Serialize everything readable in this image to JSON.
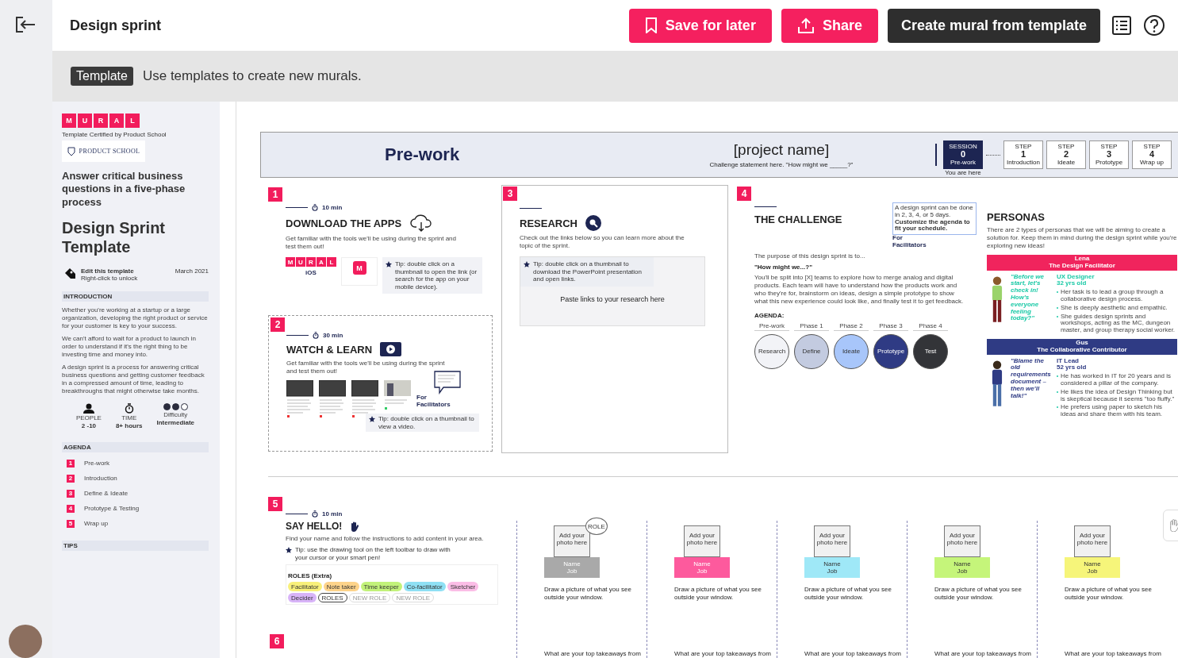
{
  "topbar": {
    "title": "Design sprint",
    "buttons": [
      {
        "label": "Save for later",
        "kind": "save"
      },
      {
        "label": "Share",
        "kind": "share"
      },
      {
        "label": "Create mural from template",
        "kind": "create"
      }
    ]
  },
  "banner": {
    "badge": "Template",
    "text": "Use templates to create new murals."
  },
  "sidebar": {
    "logo_letters": [
      "M",
      "U",
      "R",
      "A",
      "L"
    ],
    "certified": "Template Certified by Product School",
    "partner": "PRODUCT SCHOOL",
    "subtitle": "Answer critical business questions in a five-phase process",
    "title": "Design Sprint Template",
    "edit_title": "Edit this template",
    "edit_hint": "Right-click to unlock",
    "date": "March 2021",
    "intro_heading": "INTRODUCTION",
    "intro_paragraphs": [
      "Whether you're working at a startup or a large organization, developing the right product or service for your customer is key to your success.",
      "We can't afford to wait for a product to launch in order to understand if it's the right thing to be investing time and money into.",
      "A design sprint is a process for answering critical business questions and getting customer feedback in a compressed amount of time, leading to breakthroughs that might otherwise take months."
    ],
    "stats": [
      {
        "kind": "people",
        "label": "PEOPLE",
        "value": "2 -10"
      },
      {
        "kind": "time",
        "label": "TIME",
        "value": "8+ hours"
      },
      {
        "kind": "difficulty",
        "label": "Difficulty",
        "value": "Intermediate",
        "stars": 2
      }
    ],
    "agenda_heading": "AGENDA",
    "agenda": [
      {
        "number": "1",
        "label": "Pre-work"
      },
      {
        "number": "2",
        "label": "Introduction"
      },
      {
        "number": "3",
        "label": "Define & Ideate"
      },
      {
        "number": "4",
        "label": "Prototype & Testing"
      },
      {
        "number": "5",
        "label": "Wrap up"
      }
    ],
    "tips_heading": "TIPS"
  },
  "canvas": {
    "header": {
      "title": "Pre-work",
      "project": "[project name]",
      "challenge": "Challenge statement here. \"How might we _____?\"",
      "here_note": "You are here",
      "steps": [
        {
          "label": "SESSION",
          "number": "0",
          "name": "Pre-work",
          "selected": true
        },
        {
          "label": "STEP",
          "number": "1",
          "name": "Introduction",
          "selected": false
        },
        {
          "label": "STEP",
          "number": "2",
          "name": "Ideate",
          "selected": false
        },
        {
          "label": "STEP",
          "number": "3",
          "name": "Prototype",
          "selected": false
        },
        {
          "label": "STEP",
          "number": "4",
          "name": "Wrap up",
          "selected": false
        }
      ]
    },
    "download": {
      "number": "1",
      "time": "10 min",
      "title": "DOWNLOAD THE APPS",
      "text": "Get familiar with the tools we'll be using during the sprint and test them out!",
      "logo_letters": [
        "M",
        "U",
        "R",
        "A",
        "L"
      ],
      "platform": "iOS",
      "app_letter": "M",
      "tip": "Tip: double click on a thumbnail to open the link (or search for the app on your mobile device)."
    },
    "watch": {
      "number": "2",
      "time": "30 min",
      "title": "WATCH & LEARN",
      "text": "Get familiar with the tools we'll be using during the sprint and test them out!",
      "videos": [
        {
          "kind": "slides"
        },
        {
          "kind": "slides"
        },
        {
          "kind": "slides"
        },
        {
          "kind": "photo"
        }
      ],
      "facilitators": "For Facilitators",
      "tip": "Tip: double click on a thumbnail to view a video."
    },
    "research": {
      "number": "3",
      "title": "RESEARCH",
      "text": "Check out the links below so you can learn more about the topic of the sprint.",
      "tip": "Tip: double click on a thumbnail to download the PowerPoint presentation and open links.",
      "paste": "Paste links to your research here"
    },
    "challenge": {
      "number": "4",
      "title": "THE CHALLENGE",
      "note": "A design sprint can be done in 2, 3, 4, or 5 days. **Customize the agenda to fit your schedule.**",
      "facilitators": "For Facilitators",
      "purpose": "The purpose of this design sprint is to...",
      "question": "\"How might we...?\"",
      "text": "You'll be split into [X] teams to explore how to merge analog and digital products. Each team will have to understand how the products work and who they're for, brainstorm on ideas, design a simple prototype to show what this new experience could look like, and finally test it to get feedback.",
      "agenda_heading": "AGENDA:",
      "phases": [
        {
          "phase": "Pre-work",
          "name": "Research",
          "color": "#f2f3f7"
        },
        {
          "phase": "Phase 1",
          "name": "Define",
          "color": "#c3cbe0"
        },
        {
          "phase": "Phase 2",
          "name": "Ideate",
          "color": "#a8c6fa"
        },
        {
          "phase": "Phase 3",
          "name": "Prototype",
          "color": "#2f3b84"
        },
        {
          "phase": "Phase 4",
          "name": "Test",
          "color": "#333438"
        }
      ]
    },
    "personas": {
      "title": "PERSONAS",
      "text": "There are 2 types of personas that we will be aiming to create a solution for. Keep them in mind during the design sprint while you're exploring new ideas!",
      "people": [
        {
          "name": "Lena",
          "role": "The Design Facilitator",
          "color": "#f0245d",
          "quote": "\"Before we start, let's check in! How's everyone feeling today?\"",
          "job": "UX Designer",
          "age": "32 yrs old",
          "bullets": [
            "Her task is to lead a group through a collaborative design process.",
            "She is deeply aesthetic and empathic.",
            "She guides design sprints and workshops, acting as the MC, dungeon master, and group therapy social worker."
          ]
        },
        {
          "name": "Gus",
          "role": "The Collaborative Contributor",
          "color": "#2f3b84",
          "quote": "\"Blame the old requirements document – then we'll talk!\"",
          "job": "IT Lead",
          "age": "52 yrs old",
          "bullets": [
            "He has worked in IT for 20 years and is considered a pillar of the company.",
            "He likes the idea of Design Thinking but is skeptical because it seems \"too fluffy.\"",
            "He prefers using paper to sketch his ideas and share them with his team."
          ]
        }
      ]
    },
    "hello": {
      "number": "5",
      "time": "10 min",
      "title": "SAY HELLO!",
      "text": "Find your name and follow the instructions to add content in your area.",
      "tip": "Tip: use the drawing tool on the left toolbar to draw with your cursor or your smart pen!",
      "roles_heading": "ROLES (Extra)",
      "roles": [
        {
          "kind": "filled",
          "label": "Facilitator",
          "color": "#f8f07a"
        },
        {
          "kind": "filled",
          "label": "Note taker",
          "color": "#fdd38a"
        },
        {
          "kind": "filled",
          "label": "Time keeper",
          "color": "#c2f27a"
        },
        {
          "kind": "filled",
          "label": "Co-facilitator",
          "color": "#8fe0f4"
        },
        {
          "kind": "filled",
          "label": "Sketcher",
          "color": "#fbbde6"
        },
        {
          "kind": "filled",
          "label": "Decider",
          "color": "#d8b4f8"
        },
        {
          "kind": "outline",
          "label": "ROLES"
        },
        {
          "kind": "empty",
          "label": "NEW ROLE"
        },
        {
          "kind": "empty",
          "label": "NEW ROLE"
        }
      ]
    },
    "participants": [
      {
        "color": "#a9a9a9",
        "photo": "Add your photo here",
        "role": "ROLE",
        "name": "Name",
        "job": "Job",
        "prompt": "Draw a picture of what you see outside your window.",
        "question": "What are your top takeaways from"
      },
      {
        "color": "#fd5a9d",
        "photo": "Add your photo here",
        "name": "Name",
        "job": "Job",
        "prompt": "Draw a picture of what you see outside your window.",
        "question": "What are your top takeaways from"
      },
      {
        "color": "#9fe8f7",
        "photo": "Add your photo here",
        "name": "Name",
        "job": "Job",
        "prompt": "Draw a picture of what you see outside your window.",
        "question": "What are your top takeaways from"
      },
      {
        "color": "#c5f57a",
        "photo": "Add your photo here",
        "name": "Name",
        "job": "Job",
        "prompt": "Draw a picture of what you see outside your window.",
        "question": "What are your top takeaways from"
      },
      {
        "color": "#f6f57a",
        "photo": "Add your photo here",
        "name": "Name",
        "job": "Job",
        "prompt": "Draw a picture of what you see outside your window.",
        "question": "What are your top takeaways from"
      }
    ],
    "section_6": {
      "number": "6"
    }
  }
}
